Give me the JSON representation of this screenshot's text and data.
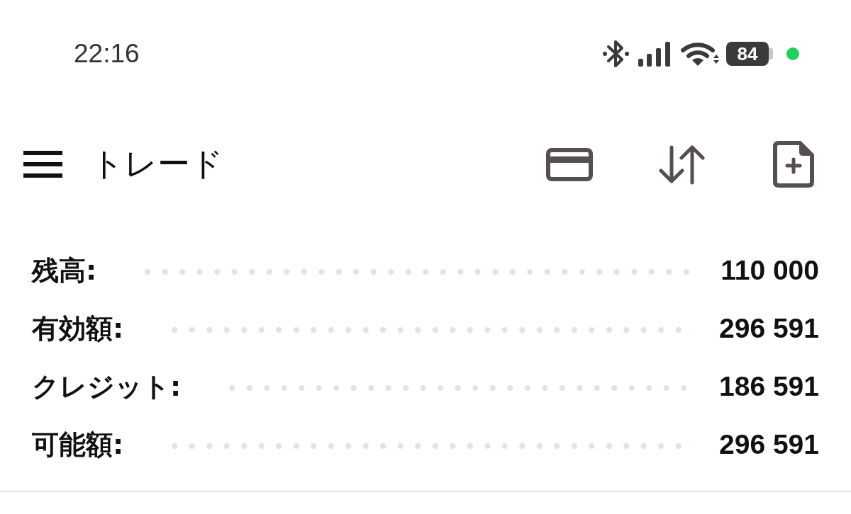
{
  "status_bar": {
    "time": "22:16",
    "battery": "84"
  },
  "toolbar": {
    "title": "トレード"
  },
  "account_summary": [
    {
      "label": "残高:",
      "value": "110 000"
    },
    {
      "label": "有効額:",
      "value": "296 591"
    },
    {
      "label": "クレジット:",
      "value": "186 591"
    },
    {
      "label": "可能額:",
      "value": "296 591"
    }
  ]
}
